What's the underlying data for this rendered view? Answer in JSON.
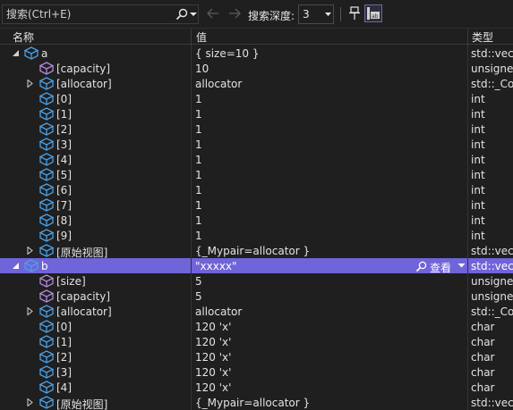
{
  "toolbar": {
    "search_placeholder": "搜索(Ctrl+E)",
    "depth_label": "搜索深度:",
    "depth_value": "3"
  },
  "columns": {
    "name": "名称",
    "value": "值",
    "type": "类型"
  },
  "rows": [
    {
      "depth": 0,
      "expander": "expanded",
      "icon": "object-icon",
      "name": "a",
      "value": "{ size=10 }",
      "type": "std::vecto"
    },
    {
      "depth": 1,
      "expander": "none",
      "icon": "field-icon",
      "name": "[capacity]",
      "value": "10",
      "type": "unsigned"
    },
    {
      "depth": 1,
      "expander": "collapsed",
      "icon": "object-icon",
      "name": "[allocator]",
      "value": "allocator",
      "type": "std::_Con"
    },
    {
      "depth": 1,
      "expander": "none",
      "icon": "object-icon",
      "name": "[0]",
      "value": "1",
      "type": "int"
    },
    {
      "depth": 1,
      "expander": "none",
      "icon": "object-icon",
      "name": "[1]",
      "value": "1",
      "type": "int"
    },
    {
      "depth": 1,
      "expander": "none",
      "icon": "object-icon",
      "name": "[2]",
      "value": "1",
      "type": "int"
    },
    {
      "depth": 1,
      "expander": "none",
      "icon": "object-icon",
      "name": "[3]",
      "value": "1",
      "type": "int"
    },
    {
      "depth": 1,
      "expander": "none",
      "icon": "object-icon",
      "name": "[4]",
      "value": "1",
      "type": "int"
    },
    {
      "depth": 1,
      "expander": "none",
      "icon": "object-icon",
      "name": "[5]",
      "value": "1",
      "type": "int"
    },
    {
      "depth": 1,
      "expander": "none",
      "icon": "object-icon",
      "name": "[6]",
      "value": "1",
      "type": "int"
    },
    {
      "depth": 1,
      "expander": "none",
      "icon": "object-icon",
      "name": "[7]",
      "value": "1",
      "type": "int"
    },
    {
      "depth": 1,
      "expander": "none",
      "icon": "object-icon",
      "name": "[8]",
      "value": "1",
      "type": "int"
    },
    {
      "depth": 1,
      "expander": "none",
      "icon": "object-icon",
      "name": "[9]",
      "value": "1",
      "type": "int"
    },
    {
      "depth": 1,
      "expander": "collapsed",
      "icon": "object-icon",
      "name": "[原始视图]",
      "value": "{_Mypair=allocator }",
      "type": "std::vecto"
    },
    {
      "depth": 0,
      "expander": "expanded",
      "icon": "object-icon",
      "name": "b",
      "value": "\"xxxxx\"",
      "type": "std::vecto",
      "selected": true,
      "view_label": "查看"
    },
    {
      "depth": 1,
      "expander": "none",
      "icon": "field-icon",
      "name": "[size]",
      "value": "5",
      "type": "unsigned"
    },
    {
      "depth": 1,
      "expander": "none",
      "icon": "field-icon",
      "name": "[capacity]",
      "value": "5",
      "type": "unsigned"
    },
    {
      "depth": 1,
      "expander": "collapsed",
      "icon": "object-icon",
      "name": "[allocator]",
      "value": "allocator",
      "type": "std::_Con"
    },
    {
      "depth": 1,
      "expander": "none",
      "icon": "object-icon",
      "name": "[0]",
      "value": "120 'x'",
      "type": "char"
    },
    {
      "depth": 1,
      "expander": "none",
      "icon": "object-icon",
      "name": "[1]",
      "value": "120 'x'",
      "type": "char"
    },
    {
      "depth": 1,
      "expander": "none",
      "icon": "object-icon",
      "name": "[2]",
      "value": "120 'x'",
      "type": "char"
    },
    {
      "depth": 1,
      "expander": "none",
      "icon": "object-icon",
      "name": "[3]",
      "value": "120 'x'",
      "type": "char"
    },
    {
      "depth": 1,
      "expander": "none",
      "icon": "object-icon",
      "name": "[4]",
      "value": "120 'x'",
      "type": "char"
    },
    {
      "depth": 1,
      "expander": "collapsed",
      "icon": "object-icon",
      "name": "[原始视图]",
      "value": "{_Mypair=allocator }",
      "type": "std::vecto"
    }
  ],
  "colors": {
    "background": "#1f1f1f",
    "selected_row": "#6f64d8",
    "object_icon": "#4aa0e6",
    "field_icon": "#b08ad8"
  }
}
